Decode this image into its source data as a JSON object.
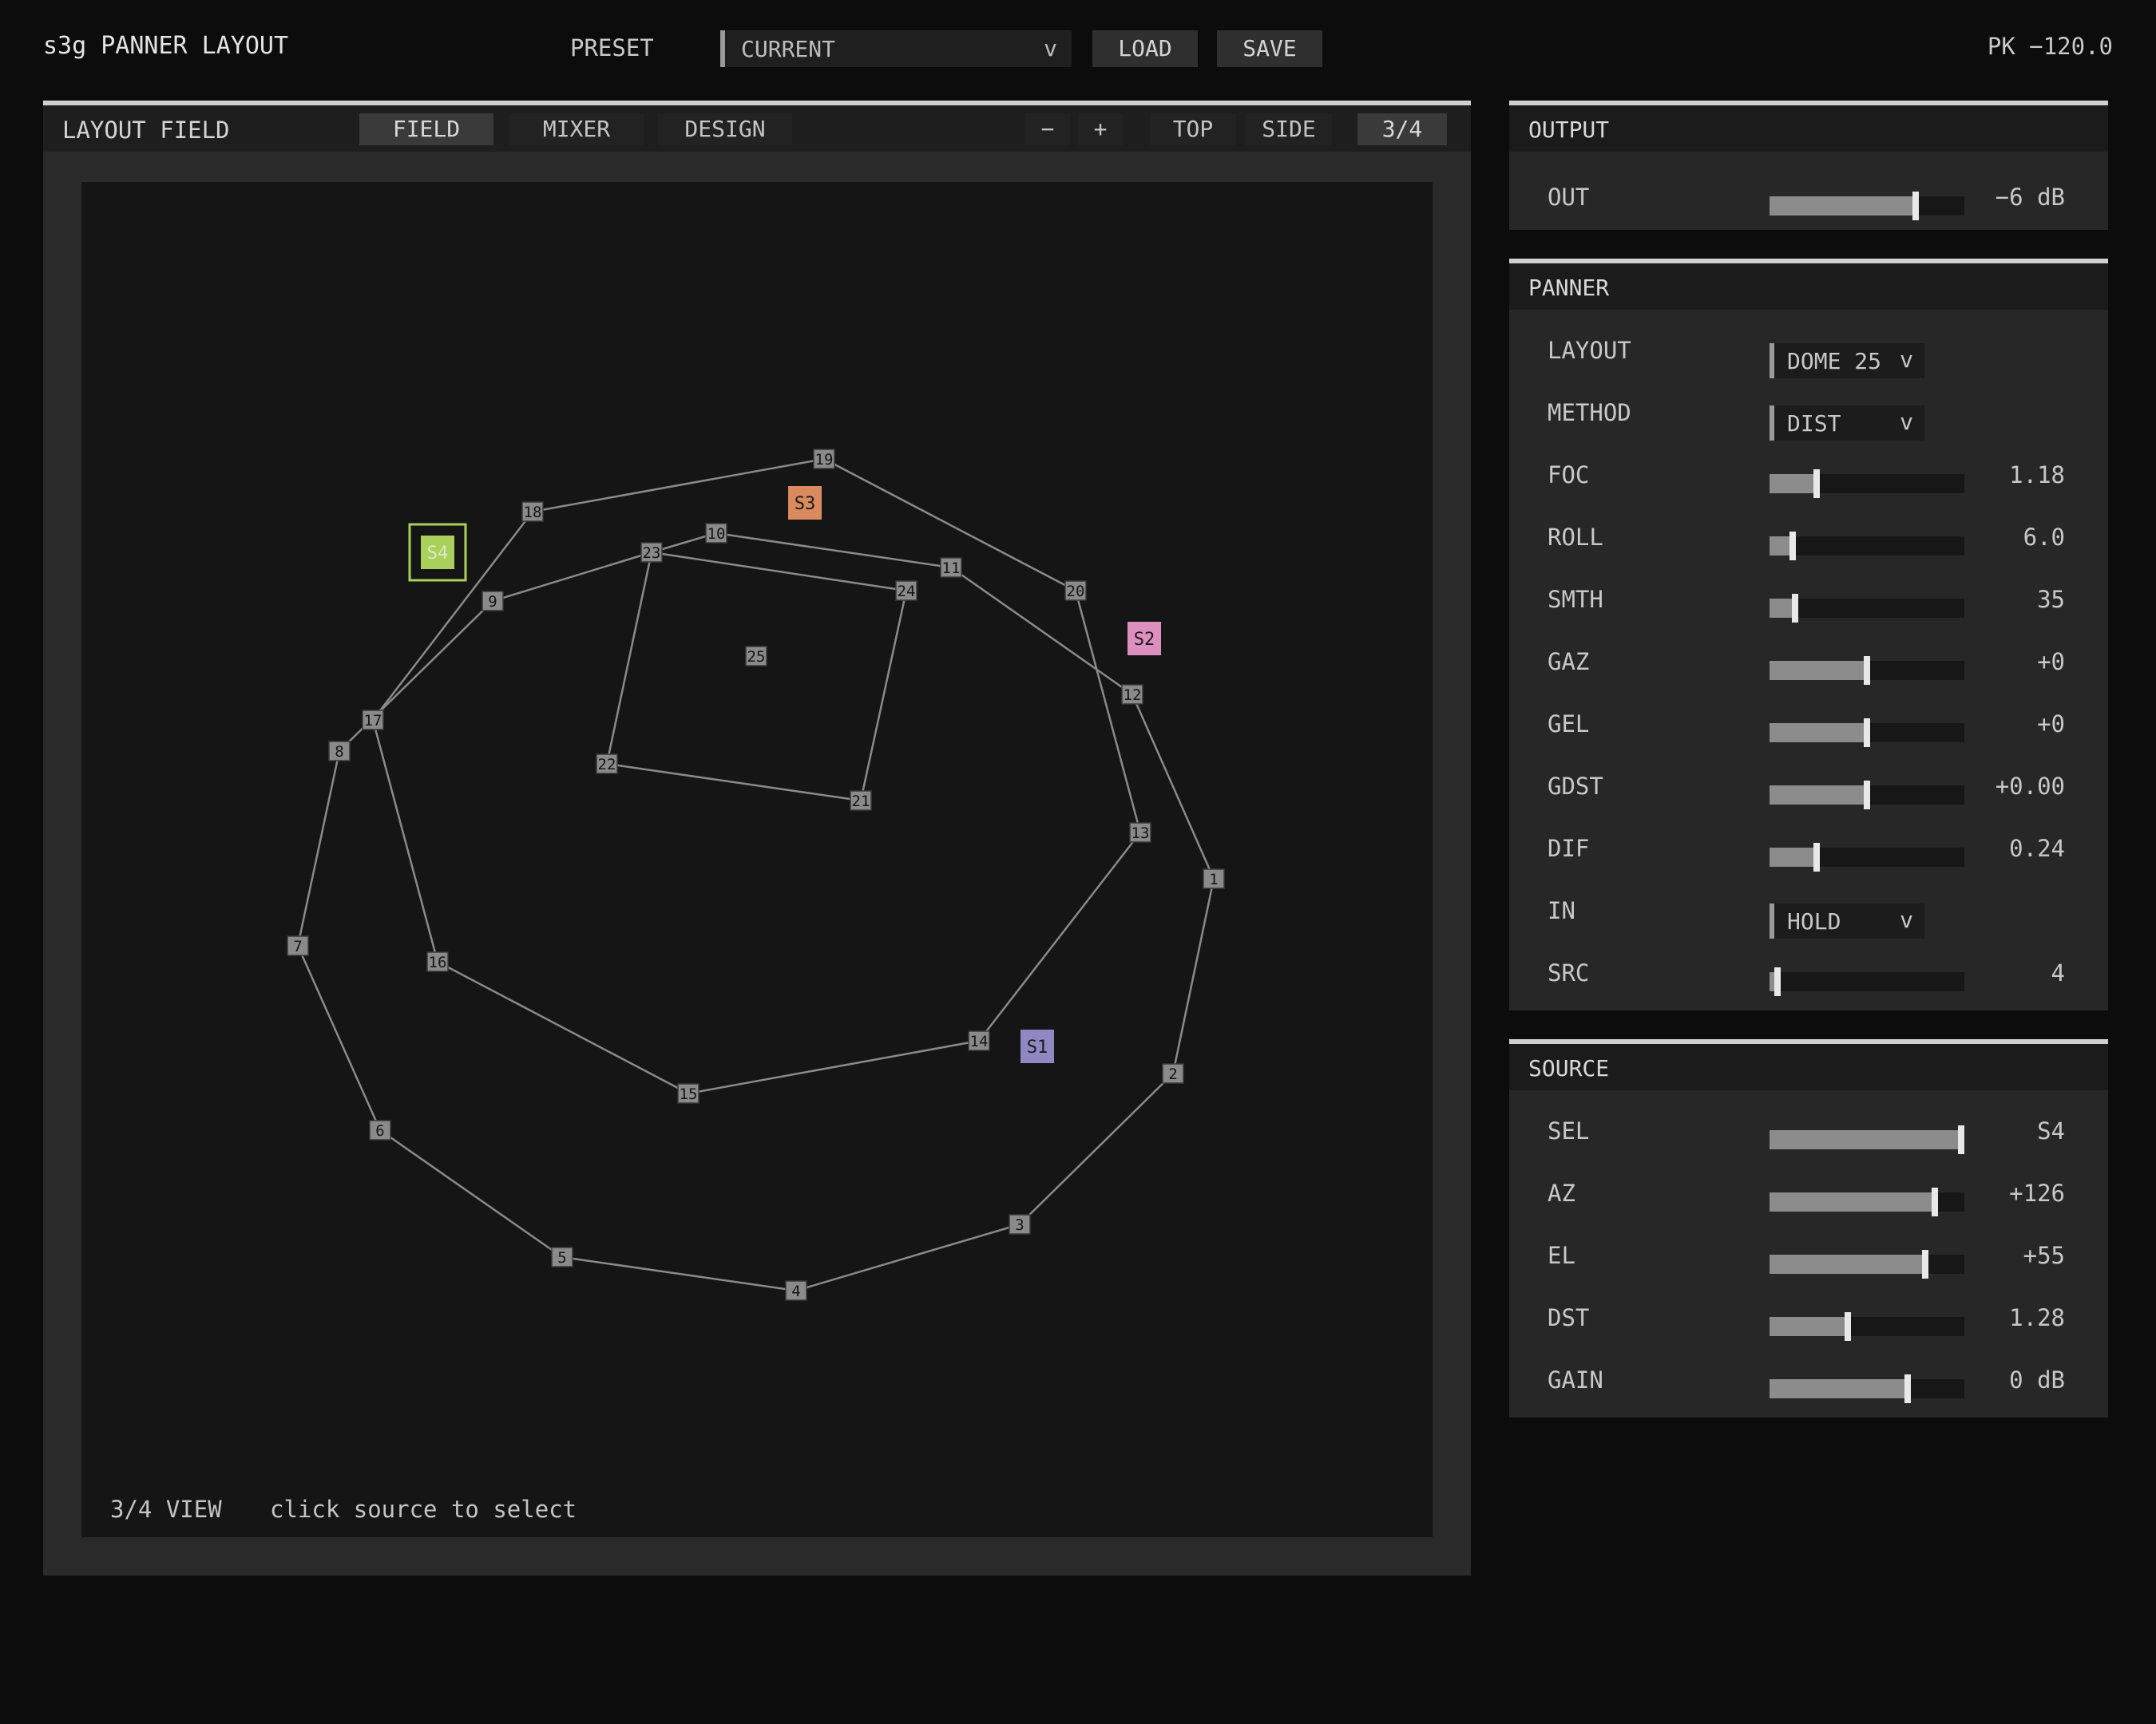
{
  "header": {
    "app_title": "s3g PANNER LAYOUT",
    "preset_label": "PRESET",
    "preset_value": "CURRENT",
    "chevron": "v",
    "load_label": "LOAD",
    "save_label": "SAVE",
    "peak_readout": "PK −120.0"
  },
  "field": {
    "title": "LAYOUT FIELD",
    "tabs": [
      {
        "label": "FIELD",
        "active": true
      },
      {
        "label": "MIXER",
        "active": false
      },
      {
        "label": "DESIGN",
        "active": false
      }
    ],
    "zoom_out_label": "−",
    "zoom_in_label": "+",
    "views": [
      {
        "label": "TOP",
        "active": false
      },
      {
        "label": "SIDE",
        "active": false
      },
      {
        "label": "3/4",
        "active": true
      }
    ],
    "status_view": "3/4 VIEW",
    "status_hint": "click source to select",
    "speakers": [
      "1",
      "2",
      "3",
      "4",
      "5",
      "6",
      "7",
      "8",
      "9",
      "10",
      "11",
      "12",
      "13",
      "14",
      "15",
      "16",
      "17",
      "18",
      "19",
      "20",
      "21",
      "22",
      "23",
      "24",
      "25"
    ],
    "sources": [
      {
        "label": "S1",
        "color": "#8f88c2"
      },
      {
        "label": "S2",
        "color": "#dd8fbf"
      },
      {
        "label": "S3",
        "color": "#d98a5e"
      },
      {
        "label": "S4",
        "color": "#a8d05a",
        "selected": true
      }
    ]
  },
  "output": {
    "title": "OUTPUT",
    "rows": [
      {
        "label": "OUT",
        "value": "−6 dB",
        "level": 0.75
      }
    ]
  },
  "panner": {
    "title": "PANNER",
    "rows": [
      {
        "label": "LAYOUT",
        "type": "dropdown",
        "value": "DOME 25"
      },
      {
        "label": "METHOD",
        "type": "dropdown",
        "value": "DIST"
      },
      {
        "label": "FOC",
        "type": "slider",
        "value": "1.18",
        "level": 0.24
      },
      {
        "label": "ROLL",
        "type": "slider",
        "value": "6.0",
        "level": 0.12
      },
      {
        "label": "SMTH",
        "type": "slider",
        "value": "35",
        "level": 0.13
      },
      {
        "label": "GAZ",
        "type": "slider",
        "value": "+0",
        "level": 0.5
      },
      {
        "label": "GEL",
        "type": "slider",
        "value": "+0",
        "level": 0.5
      },
      {
        "label": "GDST",
        "type": "slider",
        "value": "+0.00",
        "level": 0.5
      },
      {
        "label": "DIF",
        "type": "slider",
        "value": "0.24",
        "level": 0.24
      },
      {
        "label": "IN",
        "type": "dropdown",
        "value": "HOLD"
      },
      {
        "label": "SRC",
        "type": "slider",
        "value": "4",
        "level": 0.04
      }
    ]
  },
  "source": {
    "title": "SOURCE",
    "rows": [
      {
        "label": "SEL",
        "value": "S4",
        "level": 1.0
      },
      {
        "label": "AZ",
        "value": "+126",
        "level": 0.85
      },
      {
        "label": "EL",
        "value": "+55",
        "level": 0.8
      },
      {
        "label": "DST",
        "value": "1.28",
        "level": 0.4
      },
      {
        "label": "GAIN",
        "value": "0 dB",
        "level": 0.71
      }
    ]
  },
  "colors": {
    "accent_selected": "#a8d05a",
    "speaker_fill": "#8a8a8a",
    "line": "#8a8a8a"
  }
}
